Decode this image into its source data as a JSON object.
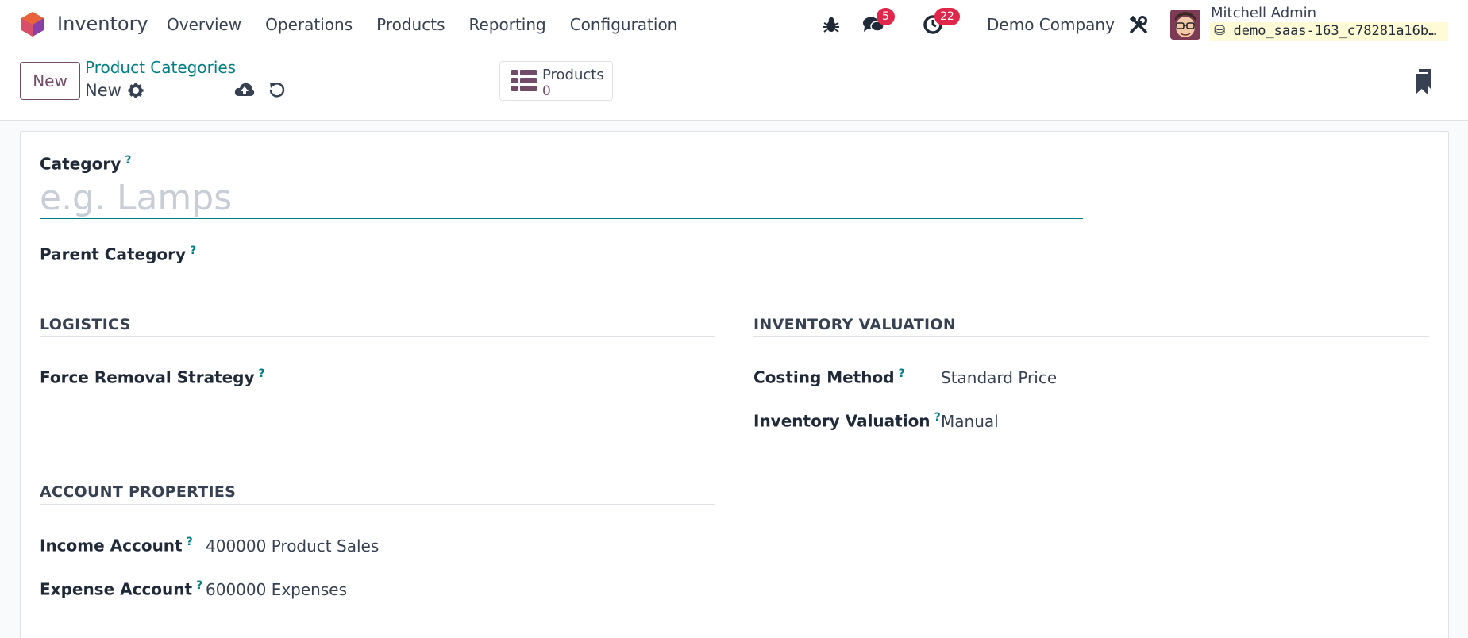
{
  "navbar": {
    "app_name": "Inventory",
    "menu": [
      "Overview",
      "Operations",
      "Products",
      "Reporting",
      "Configuration"
    ],
    "messages_count": "5",
    "activities_count": "22",
    "company": "Demo Company",
    "user_name": "Mitchell Admin",
    "database": "demo_saas-163_c78281a16b…"
  },
  "control": {
    "new_label": "New",
    "breadcrumb_parent": "Product Categories",
    "breadcrumb_current": "New",
    "smart_button": {
      "label": "Products",
      "value": "0"
    }
  },
  "form": {
    "category_label": "Category",
    "category_placeholder": "e.g. Lamps",
    "parent_label": "Parent Category",
    "help_mark": "?",
    "logistics": {
      "title": "LOGISTICS",
      "removal_label": "Force Removal Strategy"
    },
    "valuation": {
      "title": "INVENTORY VALUATION",
      "costing_label": "Costing Method",
      "costing_value": "Standard Price",
      "valuation_label": "Inventory Valuation",
      "valuation_value": "Manual"
    },
    "accounts": {
      "title": "ACCOUNT PROPERTIES",
      "income_label": "Income Account",
      "income_value": "400000 Product Sales",
      "expense_label": "Expense Account",
      "expense_value": "600000 Expenses"
    }
  },
  "colors": {
    "brand": "#714b67",
    "accent": "#017e84",
    "badge": "#e0264a"
  }
}
